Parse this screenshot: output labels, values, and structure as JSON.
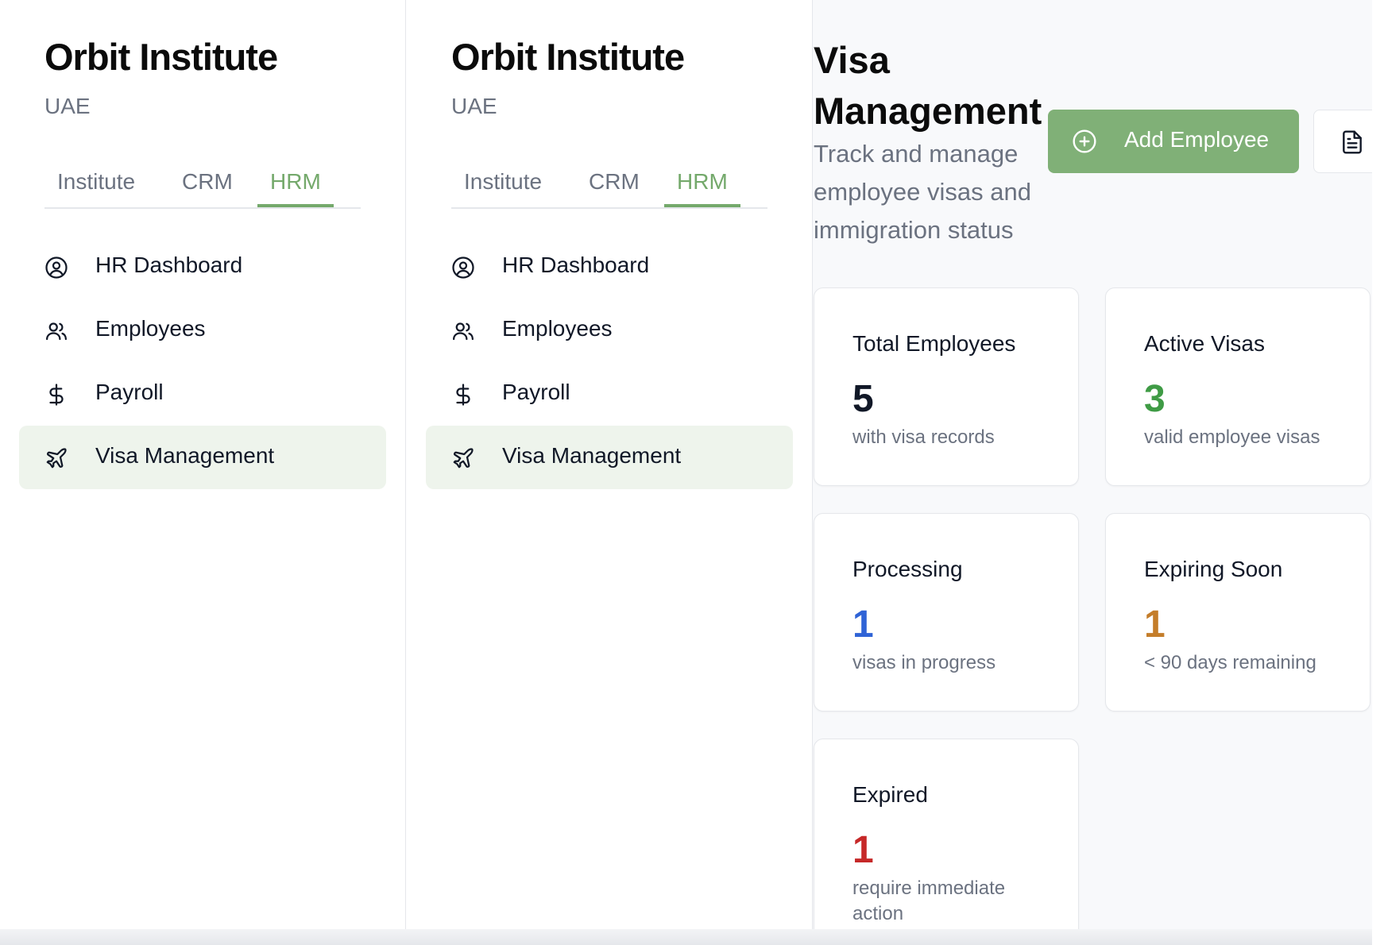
{
  "brand": {
    "title": "Orbit Institute",
    "subtitle": "UAE"
  },
  "tabs": [
    {
      "label": "Institute",
      "active": false
    },
    {
      "label": "CRM",
      "active": false
    },
    {
      "label": "HRM",
      "active": true
    }
  ],
  "nav": [
    {
      "label": "HR Dashboard",
      "icon": "user-circle-icon",
      "active": false
    },
    {
      "label": "Employees",
      "icon": "users-icon",
      "active": false
    },
    {
      "label": "Payroll",
      "icon": "dollar-icon",
      "active": false
    },
    {
      "label": "Visa Management",
      "icon": "plane-icon",
      "active": true
    }
  ],
  "main": {
    "title": "Visa Management",
    "subtitle": "Track and manage employee visas and immigration status",
    "add_button": {
      "label": "Add Employee",
      "icon": "plus-circle-icon"
    },
    "doc_button": {
      "icon": "document-icon"
    },
    "stats": [
      {
        "title": "Total Employees",
        "value": "5",
        "desc": "with visa records",
        "color": "#111827"
      },
      {
        "title": "Active Visas",
        "value": "3",
        "desc": "valid employee visas",
        "color": "#3f9b45"
      },
      {
        "title": "Processing",
        "value": "1",
        "desc": "visas in progress",
        "color": "#2f63d6"
      },
      {
        "title": "Expiring Soon",
        "value": "1",
        "desc": "< 90 days remaining",
        "color": "#c47d2a"
      },
      {
        "title": "Expired",
        "value": "1",
        "desc": "require immediate action",
        "color": "#c62828"
      }
    ]
  },
  "colors": {
    "accent": "#74a96b",
    "active_bg": "#eef4ec",
    "button_bg": "#80b077"
  }
}
